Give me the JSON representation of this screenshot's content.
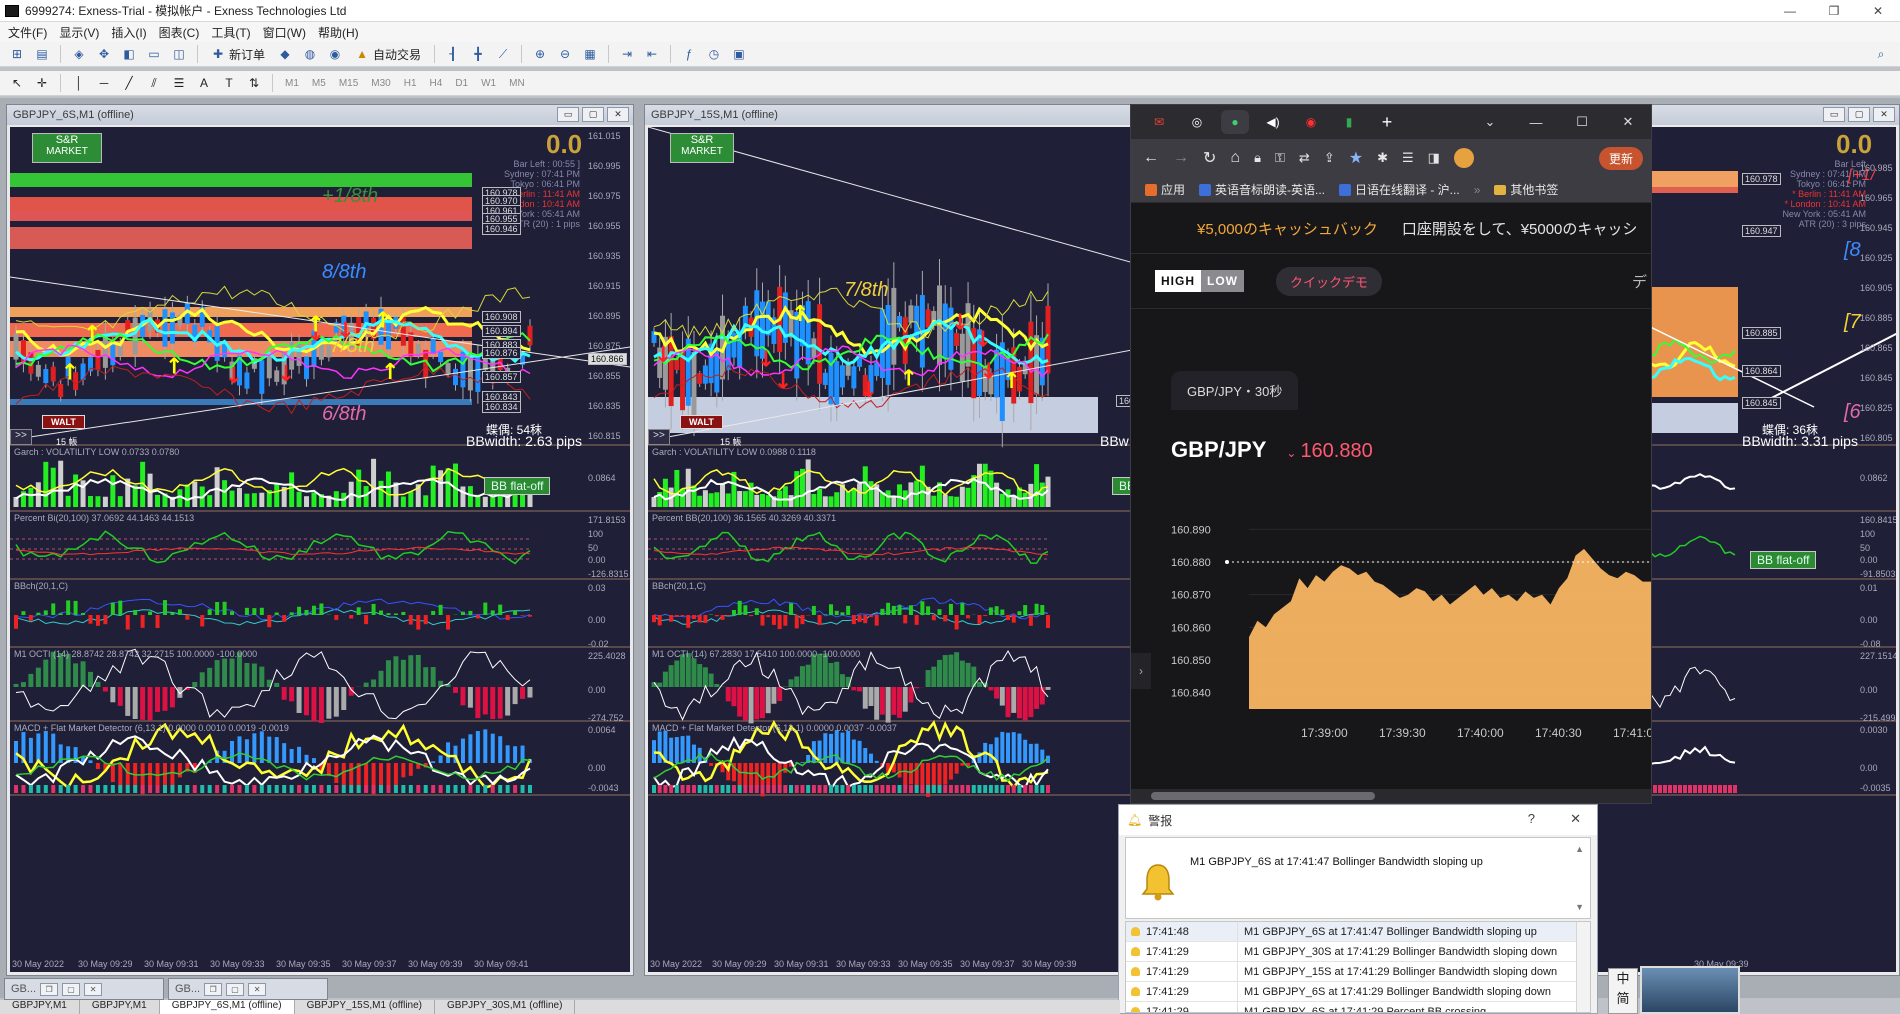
{
  "window": {
    "title": "6999274: Exness-Trial - 模拟帐户 - Exness Technologies Ltd",
    "controls": [
      "—",
      "❐",
      "✕"
    ]
  },
  "menu": [
    "文件(F)",
    "显示(V)",
    "插入(I)",
    "图表(C)",
    "工具(T)",
    "窗口(W)",
    "帮助(H)"
  ],
  "toolbar": {
    "new_order": "新订单",
    "auto_trade": "自动交易",
    "timeframes": [
      "M1",
      "M5",
      "M15",
      "M30",
      "H1",
      "H4",
      "D1",
      "W1",
      "MN"
    ]
  },
  "charts": [
    {
      "title": "GBPJPY_6S,M1 (offline)",
      "big_value": "0.0",
      "sr_labels": [
        "S&R",
        "MARKET"
      ],
      "info": [
        "Bar Left : 00:55 ]",
        "Sydney : 07:41 PM",
        "Tokyo : 06:41 PM",
        "* Berlin : 11:41 AM",
        "* London : 10:41 AM",
        "New York : 05:41 AM",
        "ATR (20) : 1 pips"
      ],
      "price_ticks": [
        "161.015",
        "160.995",
        "160.975",
        "160.955",
        "160.935",
        "160.915",
        "160.895",
        "160.875",
        "160.855",
        "160.835",
        "160.815"
      ],
      "level_boxes": [
        "160.978",
        "160.970",
        "160.961",
        "160.955",
        "160.946",
        "160.908",
        "160.894",
        "160.883",
        "160.876",
        "160.857",
        "160.843",
        "160.834"
      ],
      "current_price": "160.866",
      "eighths": [
        "+1/8th",
        "8/8th",
        "7/8th",
        "6/8th"
      ],
      "walt": "WALT",
      "bars_label": "15 帳",
      "countdown": "蝶偶: 54秣",
      "bbwidth": "BBwidth: 2.63 pips",
      "flat_label": "BB flat-off",
      "indicators": [
        {
          "label": "Garch : VOLATILITY LOW 0.0733 0.0780",
          "ticks": [
            "0.0864"
          ]
        },
        {
          "label": "Percent Bi(20,100) 37.0692 44.1463 44.1513",
          "ticks": [
            "171.8153",
            "100",
            "50",
            "0.00",
            "-126.8315"
          ]
        },
        {
          "label": "BBch(20,1,C)",
          "ticks": [
            "0.03",
            "0.00",
            "-0.02"
          ]
        },
        {
          "label": "M1 OCTI (14) 28.8742 28.8742 32.2715 100.0000 -100.0000",
          "ticks": [
            "225.4028",
            "0.00",
            "-274.752"
          ]
        },
        {
          "label": "MACD + Flat Market Detector (6,13,1) 0.0000 0.0010 0.0019 -0.0019",
          "ticks": [
            "0.0064",
            "0.00",
            "-0.0043"
          ]
        }
      ],
      "x_labels": [
        "30 May 2022",
        "30 May 09:29",
        "30 May 09:31",
        "30 May 09:33",
        "30 May 09:35",
        "30 May 09:37",
        "30 May 09:39",
        "30 May 09:41"
      ]
    },
    {
      "title": "GBPJPY_15S,M1 (offline)",
      "sr_labels": [
        "S&R",
        "MARKET"
      ],
      "eighths": [
        "7/8th"
      ],
      "walt": "WALT",
      "bars_label": "15 帳",
      "bbwidth": "BBw",
      "flat_label": "BB",
      "level_boxes": [
        "160"
      ],
      "indicators": [
        {
          "label": "Garch : VOLATILITY LOW 0.0988 0.1118"
        },
        {
          "label": "Percent BB(20,100) 36.1565 40.3269 40.3371"
        },
        {
          "label": "BBch(20,1,C)"
        },
        {
          "label": "M1 OCTI (14) 67.2830 17.5410 100.0000 -100.0000"
        },
        {
          "label": "MACD + Flat Market Detector (6,13,1) 0.0000 0.0037 -0.0037"
        }
      ],
      "x_labels": [
        "30 May 2022",
        "30 May 09:29",
        "30 May 09:31",
        "30 May 09:33",
        "30 May 09:35",
        "30 May 09:37",
        "30 May 09:39"
      ]
    },
    {
      "big_value": "0.0",
      "eighths": [
        "[+1/",
        "[8",
        "[7",
        "[6"
      ],
      "info": [
        "Bar Left",
        "Sydney : 07:41 PM",
        "Tokyo : 06:41 PM",
        "* Berlin : 11:41 AM",
        "* London : 10:41 AM",
        "New York : 05:41 AM",
        "ATR (20) : 3 pips"
      ],
      "price_ticks": [
        "160.985",
        "160.965",
        "160.945",
        "160.925",
        "160.905",
        "160.885",
        "160.865",
        "160.845",
        "160.825",
        "160.805"
      ],
      "level_boxes": [
        "160.978",
        "160.947",
        "160.885",
        "160.864",
        "160.845"
      ],
      "countdown": "蝶偶: 36秣",
      "bbwidth": "BBwidth: 3.31 pips",
      "flat_label": "BB flat-off",
      "indicator_ticks": [
        [
          "0.0862"
        ],
        [
          "160.8415",
          "100",
          "50",
          "0.00",
          "-91.8503"
        ],
        [
          "0.01",
          "0.00",
          "-0.08"
        ],
        [
          "227.1514",
          "0.00",
          "-215.4994"
        ],
        [
          "0.0030",
          "0.00",
          "-0.0035"
        ]
      ],
      "x_labels": [
        "30 May 09:39"
      ]
    }
  ],
  "browser": {
    "tabs": [
      "gmail-tab",
      "chrome-tab",
      "active-tab",
      "audio-tab",
      "youtube-tab",
      "sheets-tab"
    ],
    "controls": [
      "⌄",
      "—",
      "☐",
      "✕"
    ],
    "update_label": "更新",
    "bookmarks": [
      "应用",
      "英语音标朗读-英语...",
      "日语在线翻译 - 沪...",
      "其他书签"
    ],
    "promo": {
      "cashback": "¥5,000のキャッシュバック",
      "text": "口座開設をして、¥5000のキャッシ"
    },
    "logo": {
      "hi": "HIGH",
      "lo": "LOW"
    },
    "demo_label": "クイックデモ",
    "cut_text": "デ",
    "pair_tab": "GBP/JPY・30秒",
    "pair": "GBP/JPY",
    "price": "160.880",
    "chart_data": {
      "type": "area",
      "title": "",
      "y_ticks": [
        "160.890",
        "160.880",
        "160.870",
        "160.860",
        "160.850",
        "160.840"
      ],
      "x_ticks": [
        "17:39:00",
        "17:39:30",
        "17:40:00",
        "17:40:30",
        "17:41:00"
      ],
      "ylim": [
        160.835,
        160.895
      ],
      "current": 160.88,
      "values": [
        160.857,
        160.862,
        160.86,
        160.864,
        160.866,
        160.868,
        160.875,
        160.872,
        160.876,
        160.874,
        160.877,
        160.879,
        160.878,
        160.876,
        160.877,
        160.874,
        160.873,
        160.871,
        160.869,
        160.87,
        160.872,
        160.871,
        160.868,
        160.87,
        160.867,
        160.869,
        160.871,
        160.873,
        160.87,
        160.872,
        160.869,
        160.87,
        160.868,
        160.871,
        160.869,
        160.87,
        160.867,
        160.872,
        160.875,
        160.882,
        160.884,
        160.881,
        160.878,
        160.876,
        160.875,
        160.877,
        160.876,
        160.874,
        160.874
      ],
      "color": "#f9b562"
    }
  },
  "alert": {
    "title": "警报",
    "help": "?",
    "close": "✕",
    "message": "M1 GBPJPY_6S at 17:41:47 Bollinger Bandwidth  sloping up",
    "rows": [
      {
        "time": "17:41:48",
        "msg": "M1 GBPJPY_6S at 17:41:47 Bollinger Bandwidth  sloping up"
      },
      {
        "time": "17:41:29",
        "msg": "M1 GBPJPY_30S at 17:41:29 Bollinger Bandwidth  sloping down"
      },
      {
        "time": "17:41:29",
        "msg": "M1 GBPJPY_15S at 17:41:29 Bollinger Bandwidth  sloping down"
      },
      {
        "time": "17:41:29",
        "msg": "M1 GBPJPY_6S at 17:41:29 Bollinger Bandwidth  sloping down"
      },
      {
        "time": "17:41:29",
        "msg": "M1 GBPJPY_6S at 17:41:29 Percent BB  crossing"
      }
    ]
  },
  "bottom_tabs": [
    "GB...",
    "GB..."
  ],
  "chart_tabs": [
    "GBPJPY,M1",
    "GBPJPY,M1",
    "GBPJPY_6S,M1 (offline)",
    "GBPJPY_15S,M1 (offline)",
    "GBPJPY_30S,M1 (offline)"
  ],
  "ime_label": "中 简"
}
